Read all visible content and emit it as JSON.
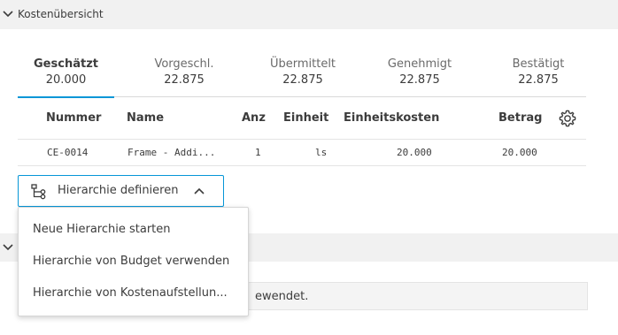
{
  "section": {
    "title": "Kostenübersicht"
  },
  "tabs": [
    {
      "label": "Geschätzt",
      "value": "20.000",
      "active": true
    },
    {
      "label": "Vorgeschl.",
      "value": "22.875"
    },
    {
      "label": "Übermittelt",
      "value": "22.875"
    },
    {
      "label": "Genehmigt",
      "value": "22.875"
    },
    {
      "label": "Bestätigt",
      "value": "22.875"
    }
  ],
  "table": {
    "headers": {
      "number": "Nummer",
      "name": "Name",
      "qty": "Anz",
      "unit": "Einheit",
      "unit_cost": "Einheitskosten",
      "amount": "Betrag"
    },
    "rows": [
      {
        "number": "CE-0014",
        "name": "Frame - Addi...",
        "qty": "1",
        "unit": "ls",
        "unit_cost": "20.000",
        "amount": "20.000"
      }
    ]
  },
  "hierarchy_button": {
    "label": "Hierarchie definieren"
  },
  "dropdown": {
    "items": [
      "Neue Hierarchie starten",
      "Hierarchie von Budget verwenden",
      "Hierarchie von Kostenaufstellun..."
    ]
  },
  "info_box": {
    "text": "ewendet."
  },
  "colors": {
    "accent": "#0696d7",
    "header_bg": "#f1f1f1"
  }
}
